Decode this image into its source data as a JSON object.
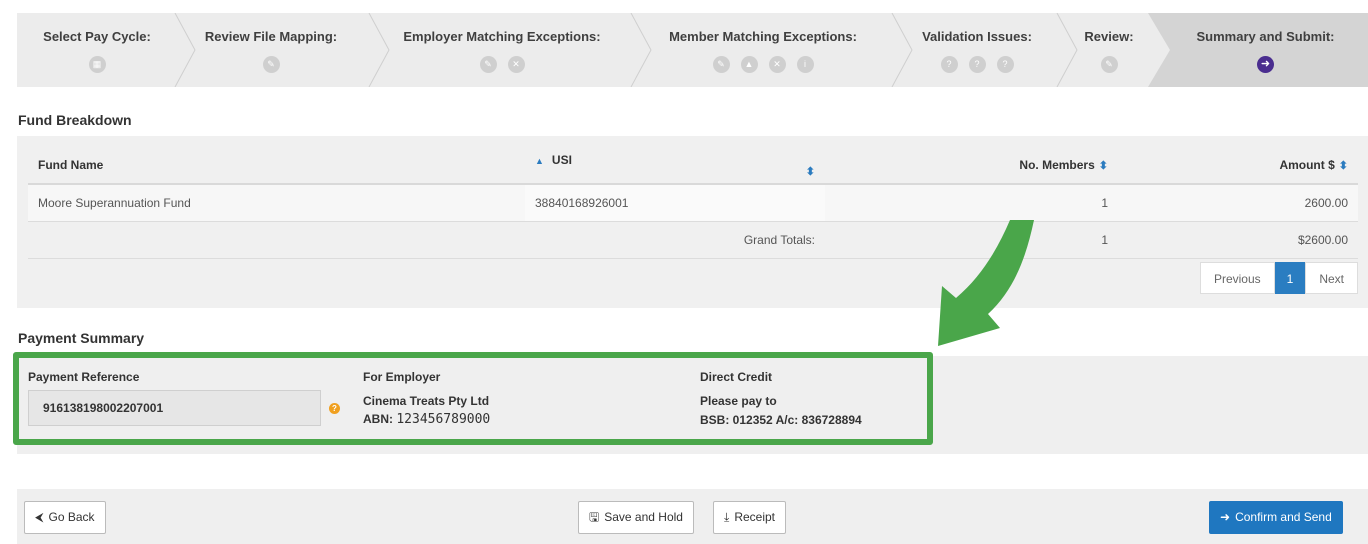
{
  "wizard": {
    "steps": [
      {
        "title": "Select Pay Cycle:",
        "icons": [
          "calendar-icon"
        ]
      },
      {
        "title": "Review File Mapping:",
        "icons": [
          "pin-icon"
        ]
      },
      {
        "title": "Employer Matching Exceptions:",
        "icons": [
          "pencil-icon",
          "close-icon"
        ]
      },
      {
        "title": "Member Matching Exceptions:",
        "icons": [
          "pencil-icon",
          "warning-icon",
          "close-icon",
          "info-icon"
        ]
      },
      {
        "title": "Validation Issues:",
        "icons": [
          "question-icon",
          "question-icon",
          "question-icon"
        ]
      },
      {
        "title": "Review:",
        "icons": [
          "edit-icon"
        ]
      },
      {
        "title": "Summary and Submit:",
        "icons": [
          "arrow-right-icon"
        ]
      }
    ]
  },
  "fund_breakdown": {
    "title": "Fund Breakdown",
    "columns": {
      "fund_name": "Fund Name",
      "usi": "USI",
      "members": "No. Members",
      "amount": "Amount $"
    },
    "rows": [
      {
        "fund_name": "Moore Superannuation Fund",
        "usi": "38840168926001",
        "members": "1",
        "amount": "2600.00"
      }
    ],
    "totals": {
      "label": "Grand Totals:",
      "members": "1",
      "amount": "$2600.00"
    },
    "pager": {
      "previous": "Previous",
      "page": "1",
      "next": "Next"
    }
  },
  "payment_summary": {
    "title": "Payment Summary",
    "reference_label": "Payment Reference",
    "reference_value": "916138198002207001",
    "employer_label": "For Employer",
    "employer_name": "Cinema Treats Pty Ltd",
    "abn_prefix": "ABN:",
    "abn_value": "123456789000",
    "credit_label": "Direct Credit",
    "credit_line1": "Please pay to",
    "credit_line2": "BSB: 012352 A/c: 836728894"
  },
  "footer": {
    "go_back": "Go Back",
    "save_hold": "Save and Hold",
    "receipt": "Receipt",
    "confirm": "Confirm and Send"
  },
  "colors": {
    "highlight": "#4aa64a",
    "primary": "#1f77c0",
    "active_step": "#4a2d8f"
  }
}
